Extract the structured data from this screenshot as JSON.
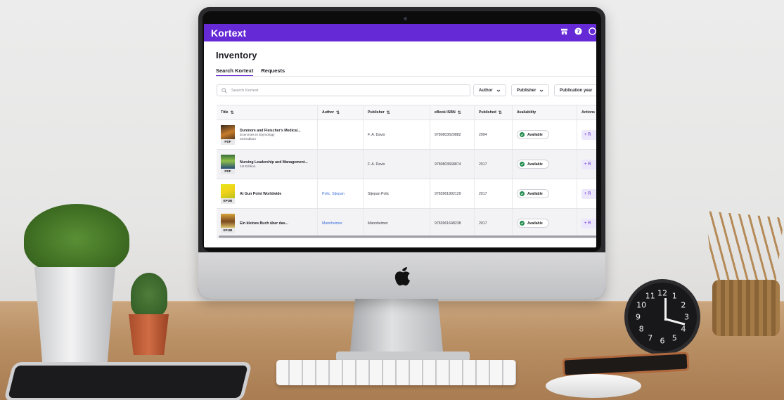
{
  "app": {
    "brand": "Kortext",
    "accent_color": "#6529d6"
  },
  "topbar": {
    "icons": [
      "store-icon",
      "help-icon",
      "account-icon"
    ]
  },
  "page": {
    "title": "Inventory"
  },
  "tabs": [
    {
      "label": "Search Kortext",
      "active": true
    },
    {
      "label": "Requests",
      "active": false
    }
  ],
  "search": {
    "placeholder": "Search Kortext",
    "value": ""
  },
  "filters": {
    "author": "Author",
    "publisher": "Publisher",
    "year": "Publication year"
  },
  "table": {
    "headers": {
      "title": "Title",
      "author": "Author",
      "publisher": "Publisher",
      "isbn": "eBook ISBN",
      "published": "Published",
      "availability": "Availability",
      "actions": "Actions"
    },
    "rows": [
      {
        "title": "Dunmore and Fleischer's Medical...",
        "subtitle": "Exercises in Etymology",
        "edition": "3rd Edition",
        "format": "PDF",
        "author": "",
        "publisher": "F. A. Davis",
        "isbn": "9780803629882",
        "published": "2004",
        "availability": "Available",
        "action": "+ R"
      },
      {
        "title": "Nursing Leadership and Management...",
        "subtitle": "1st Edition",
        "edition": "",
        "format": "PDF",
        "author": "",
        "publisher": "F. A. Davis",
        "isbn": "9780803668874",
        "published": "2017",
        "availability": "Available",
        "action": "+ R"
      },
      {
        "title": "At Gun Point Worldwide",
        "subtitle": "",
        "edition": "",
        "format": "EPUB",
        "author": "Polic, Stjepan",
        "publisher": "Stjepan Polic",
        "isbn": "9783961892129",
        "published": "2017",
        "availability": "Available",
        "action": "+ R"
      },
      {
        "title": "Ein kleines Buch über das...",
        "subtitle": "",
        "edition": "",
        "format": "EPUB",
        "author": "Mannheimer",
        "publisher": "Mannheimer",
        "isbn": "9783961648238",
        "published": "2017",
        "availability": "Available",
        "action": "+ R"
      }
    ]
  },
  "clock_numerals": [
    "10",
    "11",
    "12",
    "1",
    "2",
    "3",
    "4",
    "5",
    "6",
    "7",
    "8",
    "9"
  ]
}
